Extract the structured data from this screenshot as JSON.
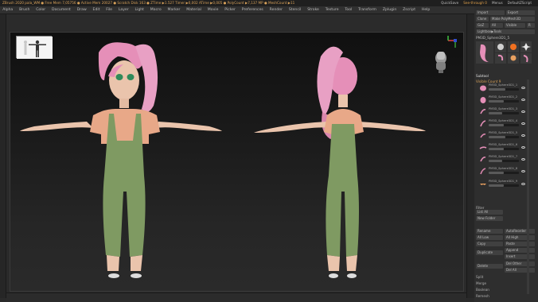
{
  "titlebar": {
    "info": "ZBrush 2020  pala_WM  ● Free Mem 7,05756  ● Active Mem 20027 ● Scratch Disk 163 ● ZTime ▶1.527 Timer ▶0,002 ATime ▶0,005 ● PolyCount ▶7,137 MP ● MeshCount ▶11",
    "right": [
      "QuickSave",
      "See-through 0",
      "Menus",
      "DefaultZScript"
    ]
  },
  "menu": [
    "Alpha",
    "Brush",
    "Color",
    "Document",
    "Draw",
    "Edit",
    "File",
    "Layer",
    "Light",
    "Macro",
    "Marker",
    "Material",
    "Movie",
    "Picker",
    "Preferences",
    "Render",
    "Stencil",
    "Stroke",
    "Texture",
    "Tool",
    "Transform",
    "Zplugin",
    "Zscript",
    "Help"
  ],
  "panel": {
    "top_buttons": [
      "Import",
      "Export",
      "Clone",
      "Make PolyMesh3D",
      "GoZ",
      "All",
      "Visible",
      "R"
    ],
    "lightbox": "Lightbox▶Tools",
    "tool_name": "PM3D_Sphere3D1_5",
    "subtool_header": "Subtool",
    "visible_count": "Visible Count 9",
    "subtools": [
      {
        "name": "PM3D_Sphere3D1_1",
        "fill": 0.55
      },
      {
        "name": "PM3D_Sphere3D1_2",
        "fill": 0.5
      },
      {
        "name": "PM3D_Sphere3D1_3",
        "fill": 0.45
      },
      {
        "name": "PM3D_Sphere3D1_4",
        "fill": 0.5
      },
      {
        "name": "PM3D_Sphere3D1_5",
        "fill": 0.55
      },
      {
        "name": "PM3D_Sphere3D1_6",
        "fill": 0.5
      },
      {
        "name": "PM3D_Sphere3D1_7",
        "fill": 0.45
      },
      {
        "name": "PM3D_Sphere3D1_8",
        "fill": 0.5
      },
      {
        "name": "PM3D_Sphere3D1_9",
        "fill": 0.5
      }
    ],
    "filter": "Filter",
    "list_all": "List All",
    "new_folder": "New Folder",
    "lower": [
      [
        "Rename",
        "AutoReorder"
      ],
      [
        "All Low",
        "All High"
      ],
      [
        "Copy",
        "Paste"
      ],
      [
        "Duplicate",
        "Append"
      ],
      [
        "",
        "Insert"
      ],
      [
        "Delete",
        "Del Other"
      ],
      [
        "",
        "Del All"
      ],
      [
        "Split",
        ""
      ],
      [
        "Merge",
        ""
      ],
      [
        "Boolean",
        ""
      ],
      [
        "Remesh",
        ""
      ]
    ]
  },
  "colors": {
    "hair": "#e58fb8",
    "skin": "#eac4ac",
    "shirt": "#e8a888",
    "overalls": "#7f9a62",
    "accent": "#d9a25a"
  }
}
